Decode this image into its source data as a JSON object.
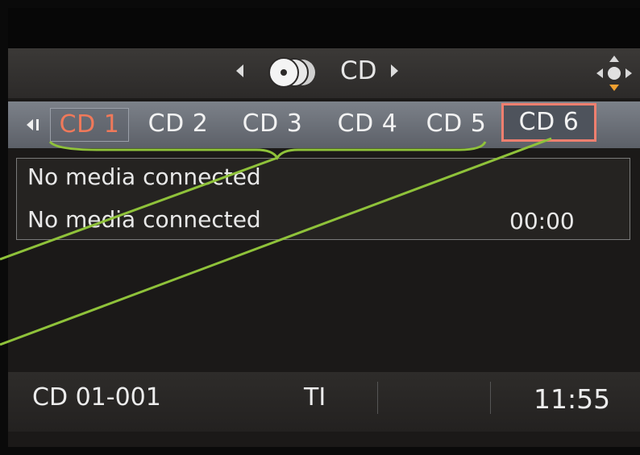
{
  "header": {
    "title": "CD",
    "source_icon": "cd-changer-icon",
    "nav_icon": "rotary-controller-icon"
  },
  "tabs": [
    {
      "label": "CD 1",
      "state": "active"
    },
    {
      "label": "CD 2",
      "state": "normal"
    },
    {
      "label": "CD 3",
      "state": "normal"
    },
    {
      "label": "CD 4",
      "state": "normal"
    },
    {
      "label": "CD 5",
      "state": "normal"
    },
    {
      "label": "CD 6",
      "state": "highlighted"
    }
  ],
  "info": {
    "line1": "No media connected",
    "line2": "No media connected",
    "time": "00:00"
  },
  "status": {
    "track": "CD 01-001",
    "ti": "TI",
    "clock": "11:55"
  },
  "colors": {
    "active_tab": "#f0795a",
    "highlight_box": "#ef7f6f",
    "annotation": "#8fc23a"
  }
}
